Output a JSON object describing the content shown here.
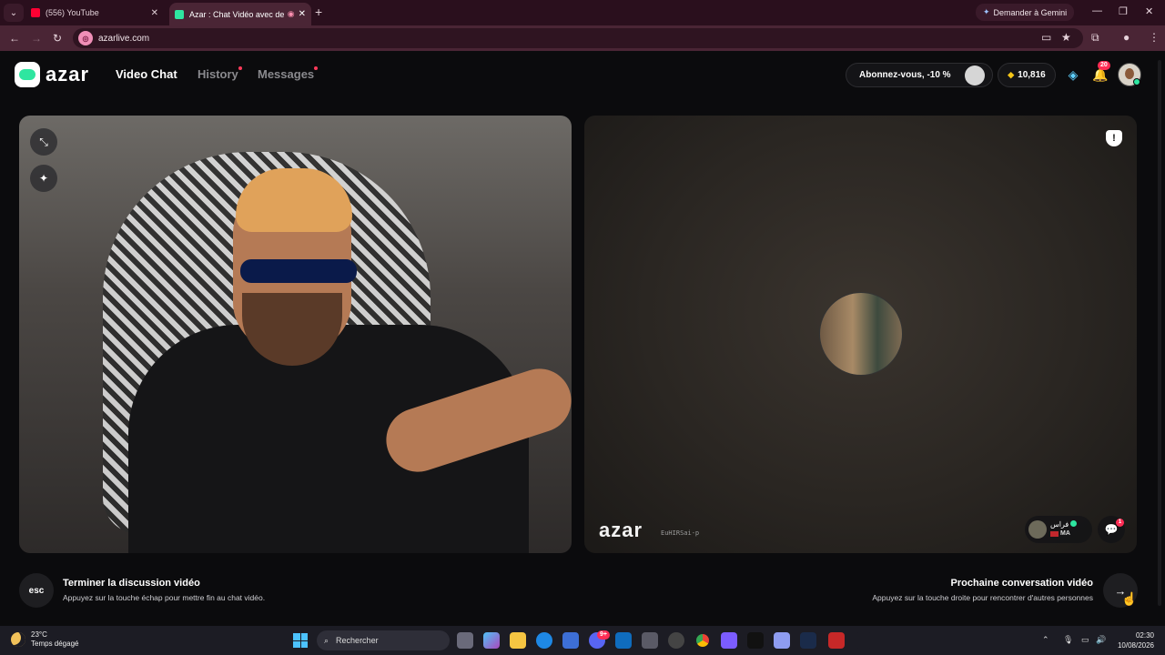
{
  "browser": {
    "tabs": [
      {
        "title": "(556) YouTube",
        "active": false
      },
      {
        "title": "Azar : Chat Vidéo avec de n",
        "active": true
      }
    ],
    "new_tab": "+",
    "gemini_button": "Demander à Gemini",
    "url": "azarlive.com",
    "window_controls": {
      "minimize": "—",
      "restore": "❐",
      "close": "✕"
    }
  },
  "app": {
    "logo_text": "azar",
    "nav": [
      {
        "label": "Video Chat",
        "current": true,
        "dot": false
      },
      {
        "label": "History",
        "current": false,
        "dot": true
      },
      {
        "label": "Messages",
        "current": false,
        "dot": true
      }
    ],
    "subscribe_label": "Abonnez-vous, -10 %",
    "gems": "10,816",
    "notification_count": "20",
    "colors": {
      "accent": "#2ee6a0",
      "alert": "#ff2d55",
      "background": "#0b0b0d"
    }
  },
  "remote": {
    "watermark": "azar",
    "watermark_id": "EuHIRSai-p",
    "partner_name": "فراس",
    "partner_country": "MA",
    "chat_badge": "1"
  },
  "hints": {
    "esc_key": "esc",
    "end_title": "Terminer la discussion vidéo",
    "end_sub": "Appuyez sur la touche échap pour mettre fin au chat vidéo.",
    "next_title": "Prochaine conversation vidéo",
    "next_sub": "Appuyez sur la touche droite pour rencontrer d'autres personnes",
    "next_key": "→"
  },
  "taskbar": {
    "temperature": "23°C",
    "weather": "Temps dégagé",
    "search_placeholder": "Rechercher",
    "time": "02:30",
    "date": "10/08/2026",
    "badge_count": "9+"
  }
}
